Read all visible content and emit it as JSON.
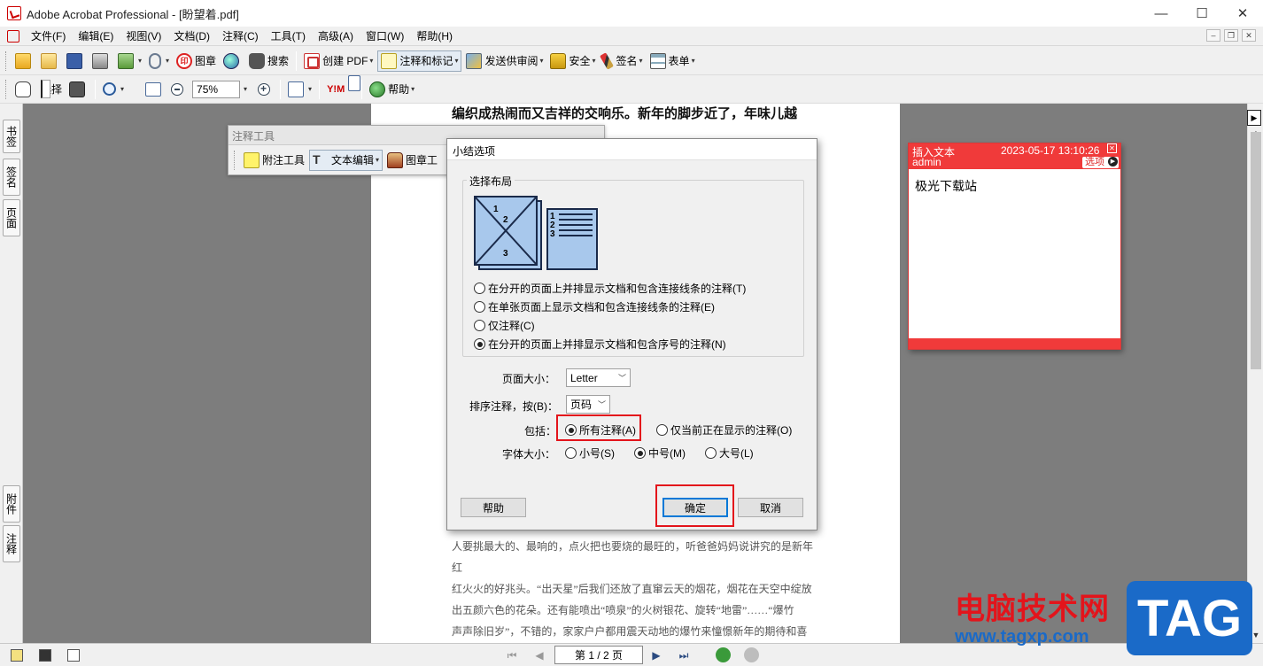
{
  "window": {
    "title": "Adobe Acrobat Professional - [盼望着.pdf]",
    "minimize": "—",
    "maximize": "☐",
    "close": "✕"
  },
  "menu": {
    "items": [
      "文件(F)",
      "编辑(E)",
      "视图(V)",
      "文档(D)",
      "注释(C)",
      "工具(T)",
      "高级(A)",
      "窗口(W)",
      "帮助(H)"
    ]
  },
  "toolbar1": {
    "stamp": "图章",
    "search": "搜索",
    "create_pdf": "创建 PDF",
    "comment_markup": "注释和标记",
    "send_review": "发送供审阅",
    "security": "安全",
    "sign": "签名",
    "forms": "表单"
  },
  "toolbar2": {
    "select": "选择",
    "zoom_value": "75%",
    "help": "帮助"
  },
  "left_tabs": {
    "bookmarks": "书签",
    "signatures": "签名",
    "pages": "页面",
    "attachments": "附件",
    "comments": "注释"
  },
  "document": {
    "heading": "编织成热闹而又吉祥的交响乐。新年的脚步近了，年味儿越",
    "lines": [
      "人要挑最大的、最响的，点火把也要烧的最旺的，听爸爸妈妈说讲究的是新年红",
      "红火火的好兆头。“出天星”后我们还放了直窜云天的烟花，烟花在天空中绽放",
      "出五颜六色的花朵。还有能喷出“喷泉”的火树银花、旋转“地雷”……“爆竹",
      "声声除旧岁”，不错的，家家户户都用震天动地的爆竹来憧憬新年的期待和喜悦。"
    ]
  },
  "comment_tools": {
    "title": "注释工具",
    "sticky_note": "附注工具",
    "text_edit": "文本编辑",
    "stamp": "图章工"
  },
  "note_popup": {
    "type": "插入文本",
    "timestamp": "2023-05-17 13:10:26",
    "author": "admin",
    "options": "选项",
    "body": "极光下载站"
  },
  "dialog": {
    "title": "小结选项",
    "layout_group": "选择布局",
    "layout_options": [
      "在分开的页面上并排显示文档和包含连接线条的注释(T)",
      "在单张页面上显示文档和包含连接线条的注释(E)",
      "仅注释(C)",
      "在分开的页面上并排显示文档和包含序号的注释(N)"
    ],
    "layout_selected": 3,
    "page_size_label": "页面大小：",
    "page_size_value": "Letter",
    "sort_label": "排序注释，按(B)：",
    "sort_value": "页码",
    "include_label": "包括：",
    "include_all": "所有注释(A)",
    "include_visible": "仅当前正在显示的注释(O)",
    "font_size_label": "字体大小：",
    "font_small": "小号(S)",
    "font_medium": "中号(M)",
    "font_large": "大号(L)",
    "help_button": "帮助",
    "ok_button": "确定",
    "cancel_button": "取消"
  },
  "statusbar": {
    "page_indicator": "第 1 / 2 页"
  },
  "watermark": {
    "site_name": "电脑技术网",
    "url": "www.tagxp.com",
    "logo": "TAG"
  },
  "colors": {
    "highlight_red": "#e3141b",
    "note_red": "#f03a3a",
    "doc_background": "#7d7d7d"
  }
}
